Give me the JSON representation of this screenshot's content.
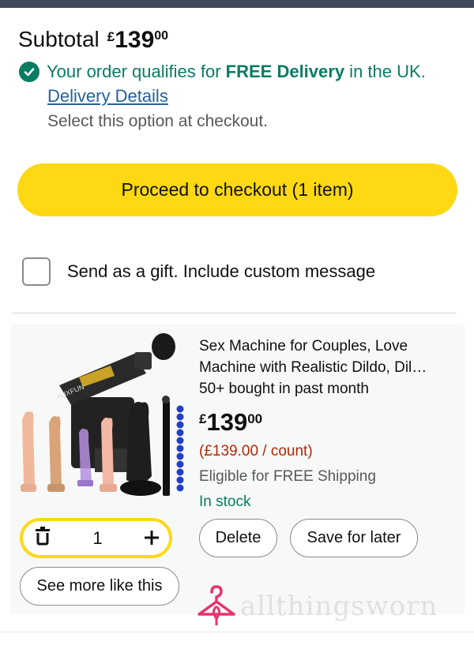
{
  "subtotal": {
    "label": "Subtotal",
    "currency": "£",
    "whole": "139",
    "fraction": "00"
  },
  "delivery": {
    "qualify_pre": "Your order qualifies for ",
    "qualify_bold": "FREE Delivery",
    "qualify_post": " in the UK.",
    "details_link": "Delivery Details",
    "select_note": "Select this option at checkout."
  },
  "checkout": {
    "button_label": "Proceed to checkout (1 item)"
  },
  "gift": {
    "label": "Send as a gift. Include custom message",
    "checked": false
  },
  "item": {
    "title": "Sex Machine for Couples, Love Machine with Realistic Dildo, Dil…",
    "bought": "50+ bought in past month",
    "price_currency": "£",
    "price_whole": "139",
    "price_fraction": "00",
    "unit_price": "(£139.00 / count)",
    "shipping": "Eligible for FREE Shipping",
    "stock": "In stock",
    "quantity": "1",
    "brand_on_image": "AUXFUN"
  },
  "actions": {
    "delete_label": "Delete",
    "save_label": "Save for later",
    "see_more_label": "See more like this"
  },
  "watermark": {
    "text": "allthingsworn"
  },
  "colors": {
    "accent_yellow": "#ffd814",
    "success_green": "#067d62",
    "link_blue": "#2162a1",
    "price_red": "#b12704",
    "watermark_pink": "#e8336e"
  },
  "icons": {
    "qualify": "check-circle-icon",
    "trash": "trash-icon",
    "plus": "plus-icon"
  }
}
